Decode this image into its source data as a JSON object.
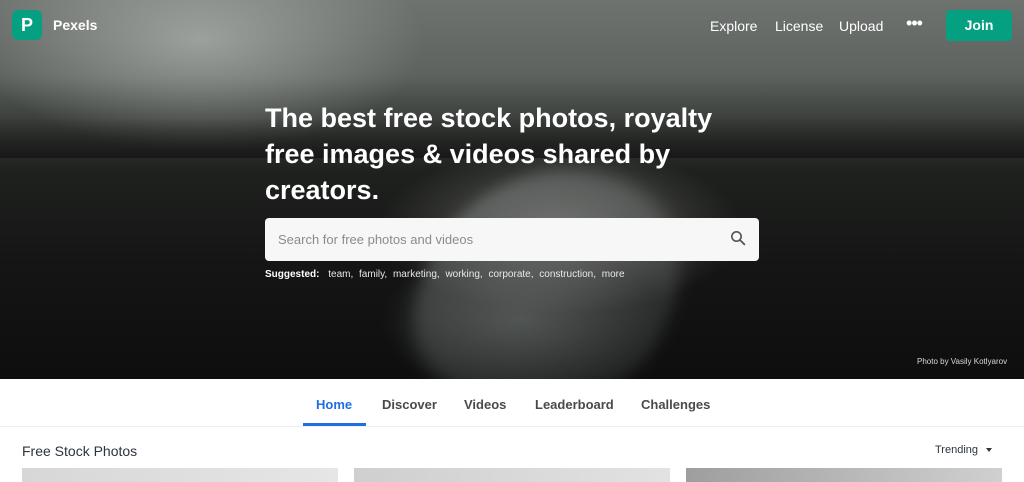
{
  "nav": {
    "brand": "Pexels",
    "logo_glyph": "P",
    "links": {
      "explore": "Explore",
      "license": "License",
      "upload": "Upload"
    },
    "more_icon": "ellipsis-icon",
    "join": "Join"
  },
  "hero": {
    "headline": "The best free stock photos, royalty free images & videos shared by creators.",
    "search": {
      "placeholder": "Search for free photos and videos"
    },
    "suggested_label": "Suggested:",
    "suggestions": [
      "team",
      "family",
      "marketing",
      "working",
      "corporate",
      "construction",
      "more"
    ],
    "credit": "Photo by Vasily Kotlyarov"
  },
  "tabs": [
    "Home",
    "Discover",
    "Videos",
    "Leaderboard",
    "Challenges"
  ],
  "active_tab": "Home",
  "section": {
    "title": "Free Stock Photos",
    "sort": "Trending"
  },
  "colors": {
    "brand_green": "#05a081",
    "active_tab_blue": "#1f6fe0"
  }
}
